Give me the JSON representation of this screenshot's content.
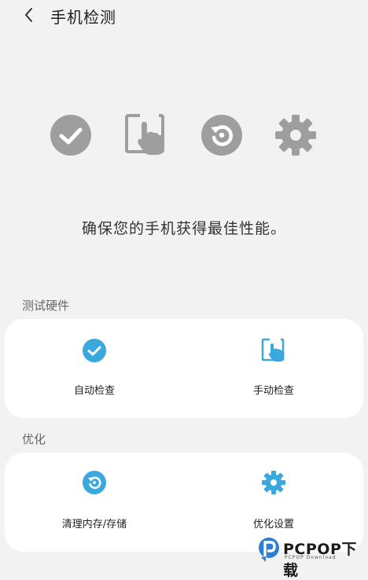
{
  "header": {
    "title": "手机检测"
  },
  "hero": {
    "message": "确保您的手机获得最佳性能。"
  },
  "sections": {
    "hardware": {
      "label": "测试硬件",
      "items": [
        {
          "label": "自动检查",
          "icon": "check-circle-icon"
        },
        {
          "label": "手动检查",
          "icon": "touch-screen-icon"
        }
      ]
    },
    "optimize": {
      "label": "优化",
      "items": [
        {
          "label": "清理内存/存储",
          "icon": "refresh-cycle-icon"
        },
        {
          "label": "优化设置",
          "icon": "gear-icon"
        }
      ]
    }
  },
  "colors": {
    "accent": "#3aa8dc",
    "hero_icon": "#9e9e9e",
    "background": "#f2f2f2",
    "card": "#ffffff"
  },
  "watermark": {
    "text": "PCPOP下载",
    "subtext": "PCPOP Download"
  }
}
